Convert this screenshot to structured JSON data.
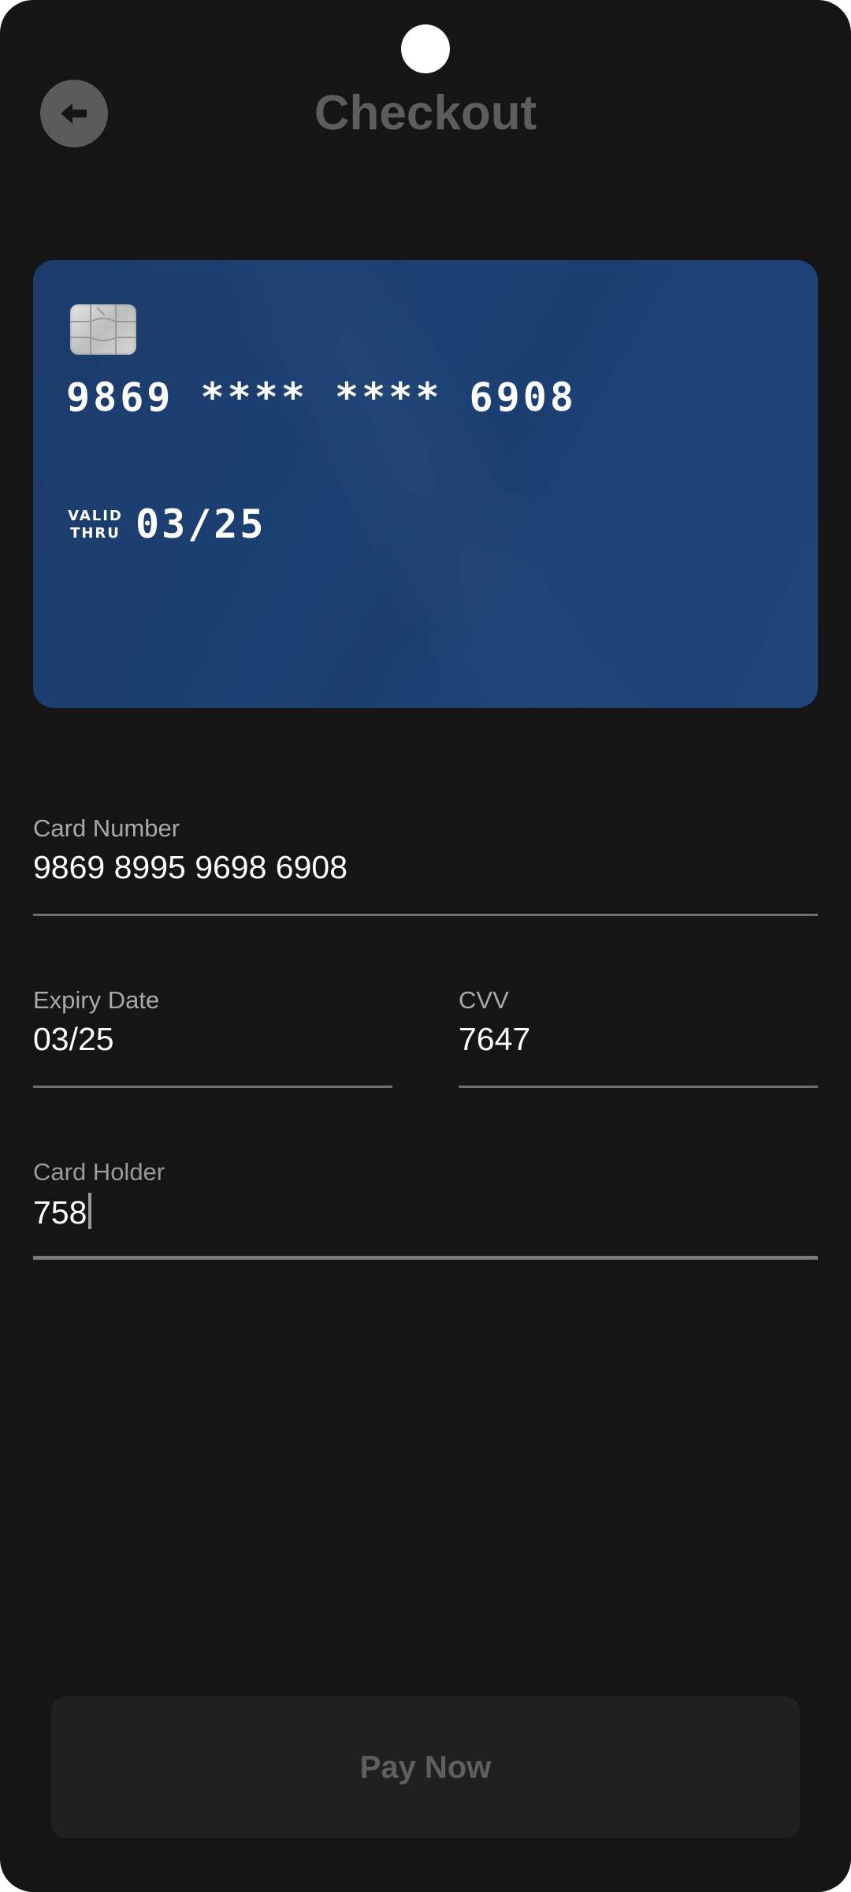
{
  "header": {
    "title": "Checkout",
    "back_icon": "arrow-left-icon"
  },
  "card_preview": {
    "chip_icon": "card-chip-icon",
    "masked_number": "9869 **** **** 6908",
    "valid_thru_line1": "VALID",
    "valid_thru_line2": "THRU",
    "expiry": "03/25",
    "card_color": "#1e4378"
  },
  "form": {
    "card_number": {
      "label": "Card Number",
      "value": "9869 8995 9698 6908"
    },
    "expiry_date": {
      "label": "Expiry Date",
      "value": "03/25"
    },
    "cvv": {
      "label": "CVV",
      "value": "7647"
    },
    "card_holder": {
      "label": "Card Holder",
      "value": "758"
    }
  },
  "actions": {
    "pay_label": "Pay Now"
  },
  "colors": {
    "background": "#151515",
    "button_bg": "#202020",
    "muted_text": "#5d5d5d"
  }
}
